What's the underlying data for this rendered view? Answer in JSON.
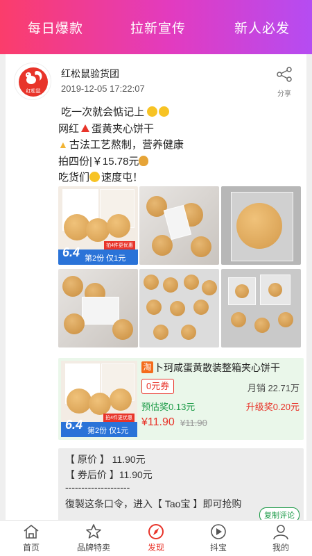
{
  "top_tabs": [
    "每日爆款",
    "拉新宣传",
    "新人必发"
  ],
  "post": {
    "avatar_label": "红松鼠",
    "publisher": "红松鼠验货团",
    "time": "2019-12-05 17:22:07",
    "share_label": "分享",
    "lines": [
      "吃一次就会惦记上",
      "网红",
      "蛋黄夹心饼干",
      "古法工艺熬制，营养健康",
      "拍四份|￥15.78元",
      "吃货们",
      "速度屯！"
    ]
  },
  "promo": {
    "number": "6.4",
    "text": "第2份 仅1元",
    "ribbon": "拍4件更优惠"
  },
  "product": {
    "platform_badge": "淘",
    "title": "卜珂咸蛋黄散装整箱夹心饼干",
    "coupon": "0元券",
    "monthly_sales": "月销 22.71万",
    "estimated_reward": "预估奖0.13元",
    "upgrade_reward": "升级奖0.20元",
    "price": "¥11.90",
    "original_price": "¥11.90"
  },
  "copy_text": {
    "original_price": "【 原价 】 11.90元",
    "coupon_price": "【 券后价 】11.90元",
    "divider": "--------------------",
    "instruction": "復製这条口令，进入【 Tao宝 】即可抢购",
    "copy_button": "复制评论"
  },
  "bottom_nav": {
    "items": [
      "首页",
      "品牌特卖",
      "发现",
      "抖宝",
      "我的"
    ],
    "active": "发现"
  },
  "colors": {
    "gradient_start": "#fb3d6b",
    "gradient_end": "#b54cf2",
    "accent_red": "#e8342a",
    "reward_green": "#1a9a46"
  }
}
